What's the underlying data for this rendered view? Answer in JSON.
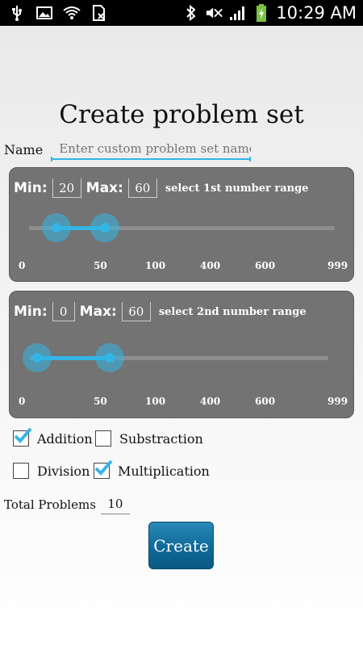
{
  "status_bar": {
    "time": "10:29 AM",
    "left_icons": [
      "usb-icon",
      "image-icon",
      "wifi-icon",
      "sim-icon"
    ],
    "right_icons": [
      "bluetooth-icon",
      "mute-icon",
      "signal-icon",
      "battery-charging-icon"
    ]
  },
  "title": "Create problem set",
  "name": {
    "label": "Name",
    "placeholder": "Enter custom problem set name"
  },
  "range1": {
    "min_label": "Min:",
    "min_value": "20",
    "max_label": "Max:",
    "max_value": "60",
    "hint": "select 1st number range",
    "ticks": [
      "0",
      "50",
      "100",
      "400",
      "600",
      "999"
    ]
  },
  "range2": {
    "min_label": "Min:",
    "min_value": "0",
    "max_label": "Max:",
    "max_value": "60",
    "hint": "select 2nd number range",
    "ticks": [
      "0",
      "50",
      "100",
      "400",
      "600",
      "999"
    ]
  },
  "operations": {
    "addition": {
      "label": "Addition",
      "checked": true
    },
    "subtraction": {
      "label": "Substraction",
      "checked": false
    },
    "division": {
      "label": "Division",
      "checked": false
    },
    "multiplication": {
      "label": "Multiplication",
      "checked": true
    }
  },
  "total": {
    "label": "Total Problems",
    "value": "10"
  },
  "create_button": "Create",
  "colors": {
    "accent": "#33b5e5",
    "panel": "#737373",
    "button": "#0f6a98"
  }
}
